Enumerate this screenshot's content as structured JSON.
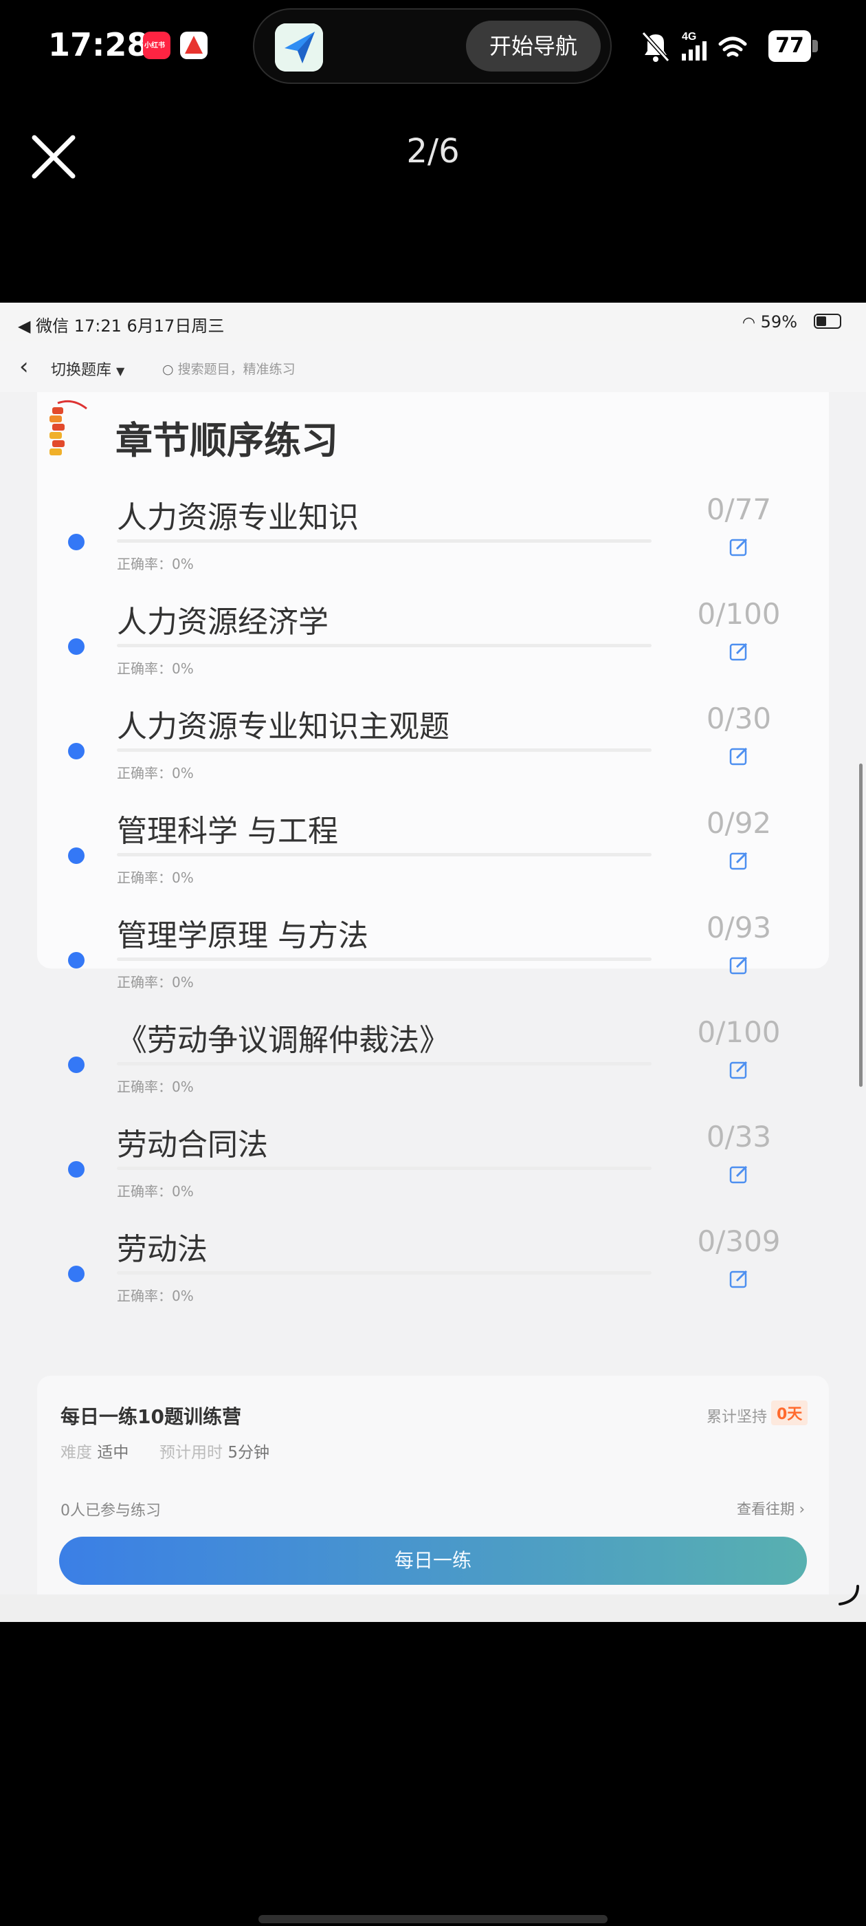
{
  "status_bar": {
    "time": "17:28",
    "badge_xhs": "小红书",
    "navigate_label": "开始导航",
    "network": "4G",
    "battery": "77"
  },
  "viewer": {
    "page_indicator": "2/6"
  },
  "inner_status": {
    "left": "◀ 微信   17:21   6月17日周三",
    "right": "59%"
  },
  "topbar": {
    "switch_bank": "切换题库",
    "search_placeholder": "搜索题目，精准练习"
  },
  "chapter": {
    "title": "章节顺序练习",
    "rate_label": "正确率：0%",
    "items": [
      {
        "name": "人力资源专业知识",
        "count": "0/77"
      },
      {
        "name": "人力资源经济学",
        "count": "0/100"
      },
      {
        "name": "人力资源专业知识主观题",
        "count": "0/30"
      },
      {
        "name": "管理科学 与工程",
        "count": "0/92"
      },
      {
        "name": "管理学原理 与方法",
        "count": "0/93"
      },
      {
        "name": "《劳动争议调解仲裁法》",
        "count": "0/100"
      },
      {
        "name": "劳动合同法",
        "count": "0/33"
      },
      {
        "name": "劳动法",
        "count": "0/309"
      }
    ]
  },
  "camp": {
    "title": "每日一练10题训练营",
    "persist_label": "累计坚持",
    "persist_days": "0天",
    "difficulty_label": "难度",
    "difficulty_value": "适中",
    "time_label": "预计用时",
    "time_value": "5分钟",
    "participants": "0人已参与练习",
    "history_link": "查看往期 ›",
    "daily_button": "每日一练"
  },
  "colors": {
    "accent_blue": "#3478f6",
    "orange": "#ff6a2e"
  }
}
